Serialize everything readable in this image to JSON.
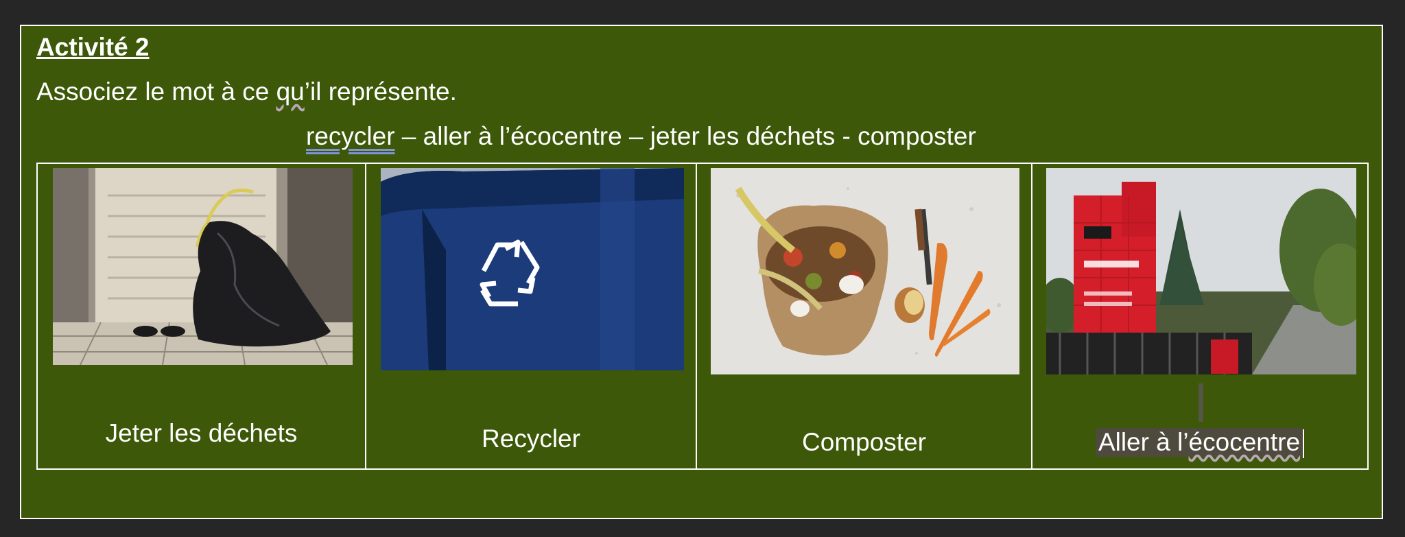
{
  "activity": {
    "title": "Activité 2",
    "instruction_before": "Associez le mot à ce ",
    "instruction_flag": "qu",
    "instruction_after": "’il représente.",
    "word_bank_first": "recycler",
    "word_bank_rest": " – aller à l’écocentre – jeter les déchets - composter"
  },
  "cards": [
    {
      "label": "Jeter les déchets",
      "image": "garbage-bag-photo"
    },
    {
      "label": "Recycler",
      "image": "recycling-bin-photo"
    },
    {
      "label": "Composter",
      "image": "compost-photo"
    },
    {
      "label_before": "Aller à l’",
      "label_flag": "écocentre",
      "image": "ecocentre-sign-photo"
    }
  ],
  "colors": {
    "page_bg": "#3c5808",
    "outer_bg": "#262626",
    "text": "#ffffff",
    "recycle_blue": "#1b3b7a",
    "ecocentre_red": "#d41f2b"
  }
}
